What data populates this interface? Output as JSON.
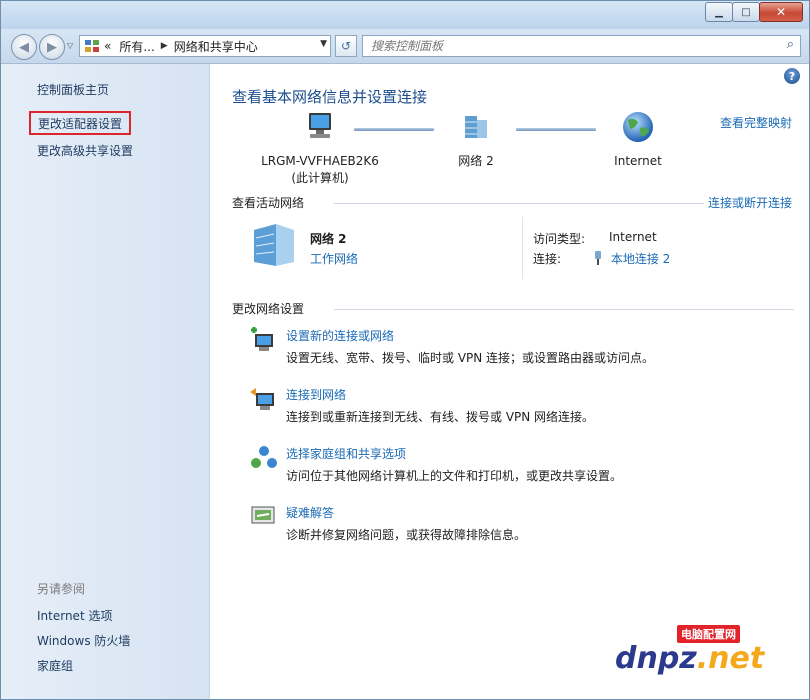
{
  "window": {
    "min_glyph": "▁",
    "max_glyph": "□",
    "close_glyph": "✕"
  },
  "address": {
    "back_glyph": "◀",
    "forward_glyph": "▶",
    "history_drop_glyph": "▽",
    "root_glyph": "«",
    "crumbs": [
      "所有...",
      "网络和共享中心"
    ],
    "crumb_sep_glyph": "▶",
    "dropdown_glyph": "▼",
    "refresh_glyph": "↺",
    "search_placeholder": "搜索控制面板",
    "search_glyph": "⌕"
  },
  "sidebar": {
    "home": "控制面板主页",
    "adapter": "更改适配器设置",
    "advanced": "更改高级共享设置",
    "see_also_title": "另请参阅",
    "see_also": [
      "Internet 选项",
      "Windows 防火墙",
      "家庭组"
    ]
  },
  "main": {
    "help_glyph": "?",
    "title": "查看基本网络信息并设置连接",
    "full_map_link": "查看完整映射",
    "map": {
      "computer_name": "LRGM-VVFHAEB2K6",
      "computer_sub": "(此计算机)",
      "network": "网络  2",
      "internet": "Internet"
    },
    "active_section": "查看活动网络",
    "connect_disconnect_link": "连接或断开连接",
    "active": {
      "name": "网络  2",
      "type": "工作网络",
      "access_label": "访问类型:",
      "access_value": "Internet",
      "connections_label": "连接:",
      "connections_value": "本地连接 2"
    },
    "change_section": "更改网络设置",
    "tasks": [
      {
        "title": "设置新的连接或网络",
        "desc": "设置无线、宽带、拨号、临时或 VPN 连接；或设置路由器或访问点。"
      },
      {
        "title": "连接到网络",
        "desc": "连接到或重新连接到无线、有线、拨号或 VPN 网络连接。"
      },
      {
        "title": "选择家庭组和共享选项",
        "desc": "访问位于其他网络计算机上的文件和打印机，或更改共享设置。"
      },
      {
        "title": "疑难解答",
        "desc": "诊断并修复网络问题，或获得故障排除信息。"
      }
    ]
  },
  "watermark": {
    "text": "dnpz",
    "dot_net": ".net",
    "badge": "电脑配置网"
  }
}
